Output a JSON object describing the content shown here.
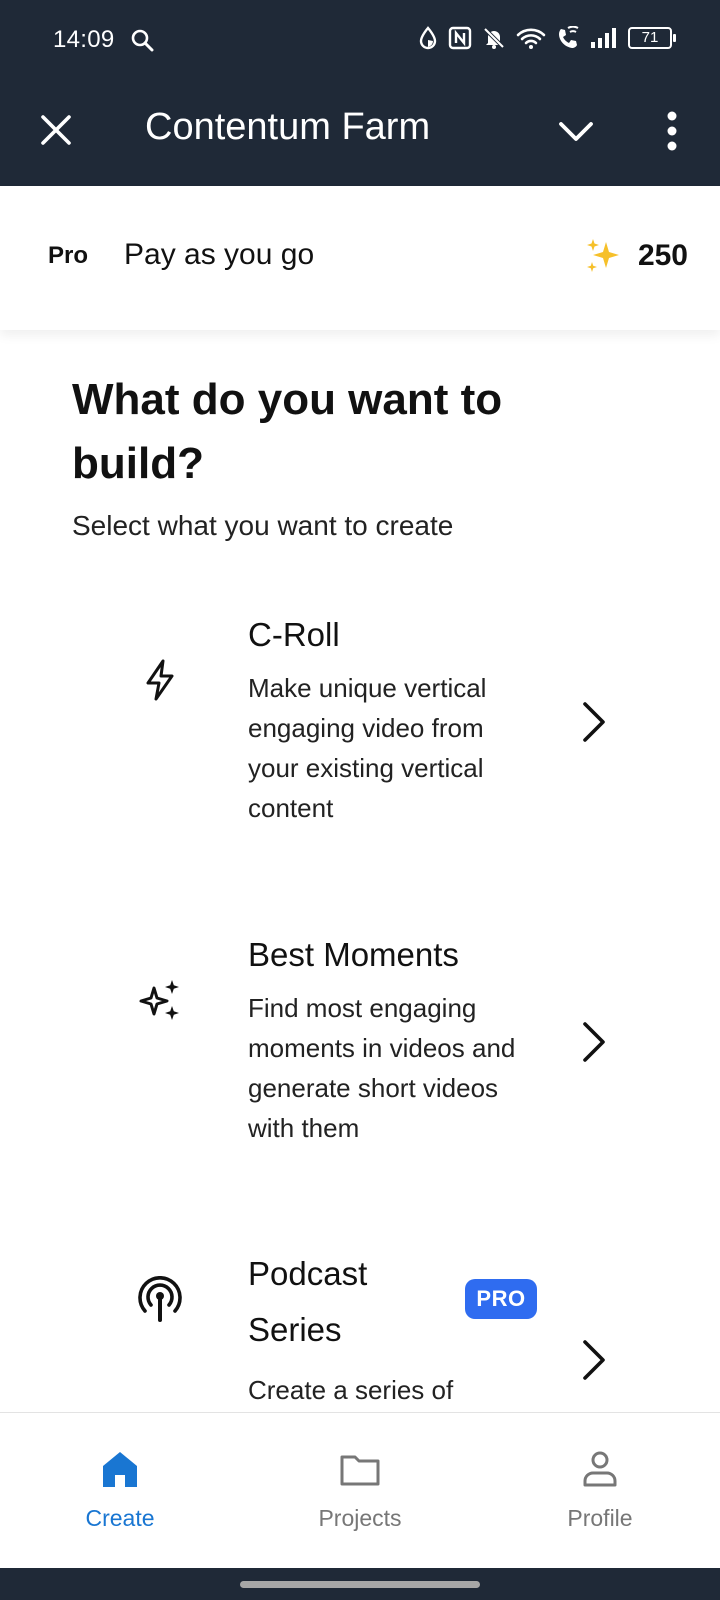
{
  "status_bar": {
    "time": "14:09",
    "battery": "71",
    "icons": [
      "search-icon",
      "data-saver-icon",
      "nfc-icon",
      "bell-muted-icon",
      "wifi-icon",
      "wifi-calling-icon",
      "cellular-signal-icon",
      "battery-icon"
    ]
  },
  "app_bar": {
    "title": "Contentum Farm",
    "icons": [
      "close-icon",
      "chevron-down-icon",
      "more-vertical-icon"
    ]
  },
  "plan": {
    "tier": "Pro",
    "name": "Pay as you go",
    "credits_icon": "sparkles-emoji-icon",
    "credits": "250"
  },
  "main": {
    "headline": "What do you want to build?",
    "subheadline": "Select what you want to create",
    "options": [
      {
        "title": "C-Roll",
        "description": "Make unique vertical engaging video from your existing vertical content",
        "icon": "lightning-icon"
      },
      {
        "title": "Best Moments",
        "description": "Find most engaging moments in videos and generate short videos with them",
        "icon": "sparkle-icon"
      },
      {
        "title": "Podcast Series",
        "badge": "PRO",
        "description": "Create a series of",
        "icon": "podcast-icon"
      }
    ]
  },
  "bottom_nav": {
    "items": [
      {
        "label": "Create",
        "icon": "home-icon",
        "active": true
      },
      {
        "label": "Projects",
        "icon": "folder-icon",
        "active": false
      },
      {
        "label": "Profile",
        "icon": "person-icon",
        "active": false
      }
    ]
  },
  "colors": {
    "header_bg": "#1f2937",
    "accent": "#1976d2",
    "pro_badge": "#2f6cf0",
    "inactive": "#777777"
  }
}
